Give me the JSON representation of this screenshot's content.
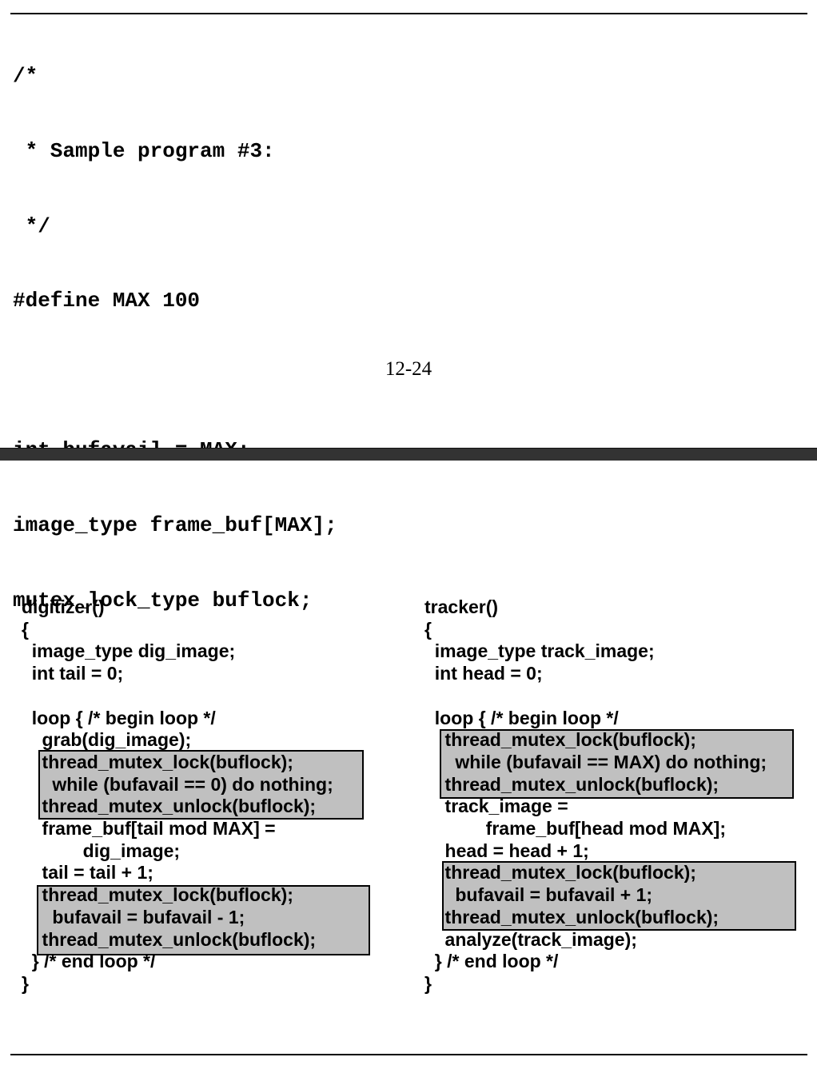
{
  "header_code": [
    "/*",
    " * Sample program #3:",
    " */",
    "#define MAX 100",
    "",
    "int bufavail = MAX;",
    "image_type frame_buf[MAX];",
    "mutex_lock_type buflock;"
  ],
  "page_number": "12-24",
  "digitizer": {
    "lines": [
      "digitizer()",
      "{",
      "  image_type dig_image;",
      "  int tail = 0;",
      "",
      "  loop { /* begin loop */",
      "    grab(dig_image);",
      "    thread_mutex_lock(buflock);",
      "      while (bufavail == 0) do nothing;",
      "    thread_mutex_unlock(buflock);",
      "    frame_buf[tail mod MAX] =",
      "            dig_image;",
      "    tail = tail + 1;",
      "    thread_mutex_lock(buflock);",
      "      bufavail = bufavail - 1;",
      "    thread_mutex_unlock(buflock);",
      "  } /* end loop */",
      "}"
    ]
  },
  "tracker": {
    "lines": [
      "tracker()",
      "{",
      "  image_type track_image;",
      "  int head = 0;",
      "",
      "  loop { /* begin loop */",
      "    thread_mutex_lock(buflock);",
      "      while (bufavail == MAX) do nothing;",
      "    thread_mutex_unlock(buflock);",
      "    track_image =",
      "            frame_buf[head mod MAX];",
      "    head = head + 1;",
      "    thread_mutex_lock(buflock);",
      "      bufavail = bufavail + 1;",
      "    thread_mutex_unlock(buflock);",
      "    analyze(track_image);",
      "  } /* end loop */",
      "}"
    ]
  }
}
